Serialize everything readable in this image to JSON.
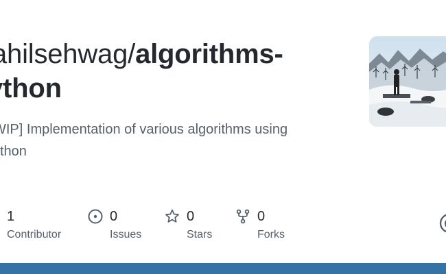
{
  "repo": {
    "owner_prefix": "ahilsehwag/",
    "name_part1": "algorithms-",
    "name_part2": "ython",
    "description_line1": "WIP] Implementation of various algorithms using",
    "description_line2": "ython"
  },
  "avatar": {
    "icon": "snowy-mountain-photo"
  },
  "stats": {
    "contributors": {
      "value": "1",
      "label": "Contributor",
      "icon": "people-icon"
    },
    "issues": {
      "value": "0",
      "label": "Issues",
      "icon": "issue-opened-icon"
    },
    "stars": {
      "value": "0",
      "label": "Stars",
      "icon": "star-icon"
    },
    "forks": {
      "value": "0",
      "label": "Forks",
      "icon": "repo-forked-icon"
    }
  },
  "colors": {
    "bottom_bar": "#3572A5",
    "text_primary": "#24292f",
    "text_secondary": "#57606a"
  }
}
